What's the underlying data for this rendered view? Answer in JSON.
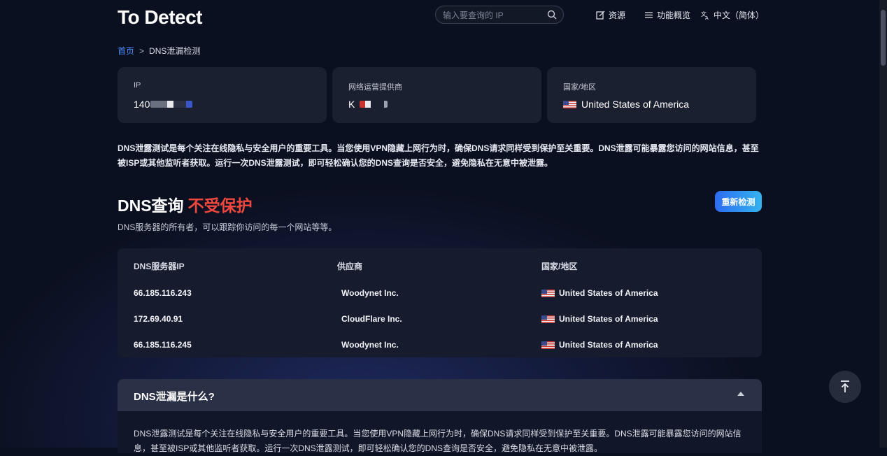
{
  "header": {
    "logo": "To Detect",
    "search_placeholder": "输入要查询的 IP",
    "nav": [
      {
        "label": "资源",
        "icon": "edit-icon"
      },
      {
        "label": "功能概览",
        "icon": "menu-icon"
      },
      {
        "label": "中文（简体）",
        "icon": "translate-icon"
      }
    ]
  },
  "breadcrumb": {
    "home": "首页",
    "separator": ">",
    "current": "DNS泄漏检测"
  },
  "cards": [
    {
      "label": "IP",
      "value": "140"
    },
    {
      "label": "网络运营提供商",
      "value": "K"
    },
    {
      "label": "国家/地区",
      "value": "United States of America"
    }
  ],
  "description": "DNS泄露测试是每个关注在线隐私与安全用户的重要工具。当您使用VPN隐藏上网行为时，确保DNS请求同样受到保护至关重要。DNS泄露可能暴露您访问的网站信息，甚至被ISP或其他监听者获取。运行一次DNS泄露测试，即可轻松确认您的DNS查询是否安全，避免隐私在无意中被泄露。",
  "section": {
    "title": "DNS查询",
    "status": "不受保护",
    "subtitle": "DNS服务器的所有者，可以跟踪你访问的每一个网站等等。",
    "recheck_label": "重新检测"
  },
  "table": {
    "headers": [
      "DNS服务器IP",
      "供应商",
      "国家/地区"
    ],
    "rows": [
      {
        "ip": "66.185.116.243",
        "provider": "Woodynet Inc.",
        "country": "United States of America"
      },
      {
        "ip": "172.69.40.91",
        "provider": "CloudFlare Inc.",
        "country": "United States of America"
      },
      {
        "ip": "66.185.116.245",
        "provider": "Woodynet Inc.",
        "country": "United States of America"
      }
    ]
  },
  "faq": {
    "title": "DNS泄漏是什么?",
    "body": "DNS泄露测试是每个关注在线隐私与安全用户的重要工具。当您使用VPN隐藏上网行为时，确保DNS请求同样受到保护至关重要。DNS泄露可能暴露您访问的网站信息，甚至被ISP或其他监听者获取。运行一次DNS泄露测试，即可轻松确认您的DNS查询是否安全，避免隐私在无意中被泄露。"
  },
  "colors": {
    "accent": "#4f8bff",
    "warning": "#f0473e",
    "button_start": "#2d6cf0",
    "button_end": "#35b3ef"
  }
}
